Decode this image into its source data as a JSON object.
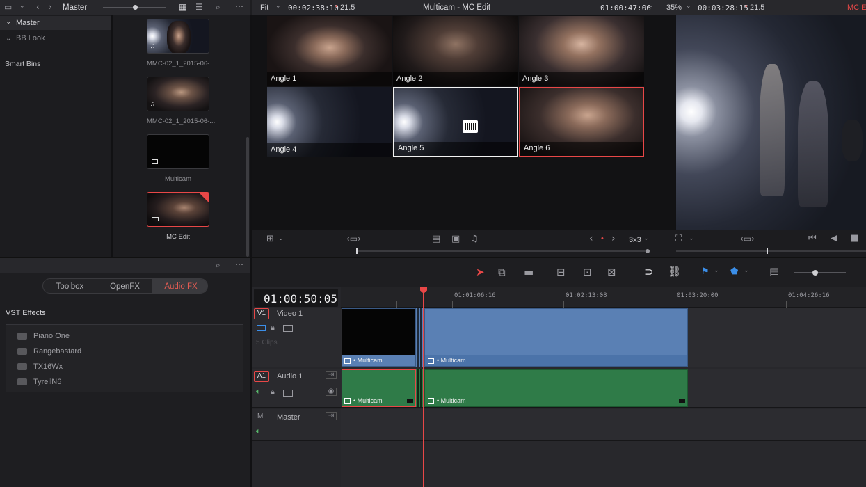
{
  "toolbar_left": {
    "bin_label": "Master"
  },
  "viewer_bar": {
    "fit_label": "Fit",
    "source_tc": "00:02:38:10",
    "source_fps": "21.5",
    "title": "Multicam - MC Edit",
    "record_tc": "01:00:47:06",
    "zoom": "35%",
    "duration_tc": "00:03:28:15",
    "record_fps": "21.5",
    "timeline_name": "MC Ed"
  },
  "bins": {
    "master": "Master",
    "bb_look": "BB Look",
    "smart_bins": "Smart Bins"
  },
  "media": [
    {
      "name": "MMC-02_1_2015-06-..."
    },
    {
      "name": "MMC-02_1_2015-06-..."
    },
    {
      "name": "Multicam"
    },
    {
      "name": "MC Edit"
    }
  ],
  "angles": [
    "Angle 1",
    "Angle 2",
    "Angle 3",
    "Angle 4",
    "Angle 5",
    "Angle 6"
  ],
  "grid_size": "3x3",
  "effects_tabs": [
    "Toolbox",
    "OpenFX",
    "Audio FX"
  ],
  "effects": {
    "heading": "VST Effects",
    "items": [
      "Piano One",
      "Rangebastard",
      "TX16Wx",
      "TyrellN6"
    ]
  },
  "timeline": {
    "timecode": "01:00:50:05",
    "ruler": [
      "01:01:06:16",
      "01:02:13:08",
      "01:03:20:00",
      "01:04:26:16"
    ],
    "v1": {
      "id": "V1",
      "name": "Video 1",
      "clip_count": "5 Clips"
    },
    "a1": {
      "id": "A1",
      "name": "Audio 1"
    },
    "master": {
      "id": "M",
      "name": "Master"
    },
    "clip_label": "• Multicam"
  },
  "colors": {
    "accent_red": "#e84747",
    "video_clip": "#5a80b4",
    "audio_clip": "#2f7b48",
    "active_tab": "#e25b52"
  }
}
